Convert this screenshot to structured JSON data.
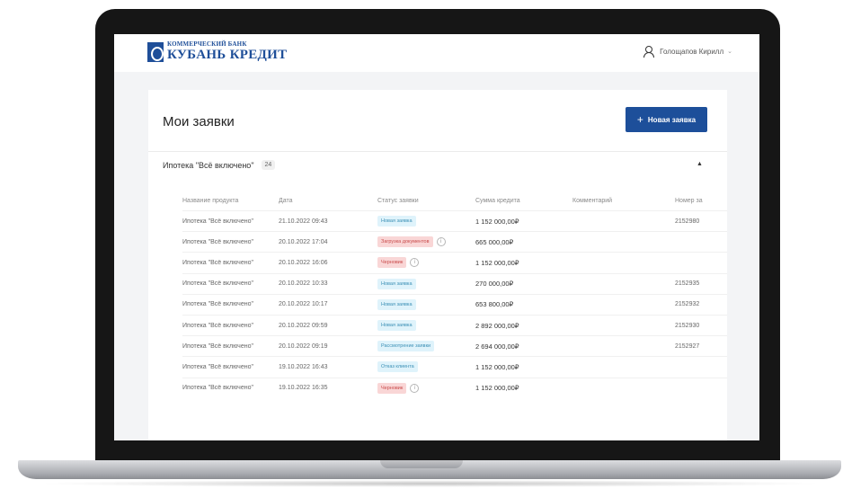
{
  "header": {
    "logo_top": "КОММЕРЧЕСКИЙ БАНК",
    "logo_main": "КУБАНЬ КРЕДИТ",
    "user_name": "Голощапов Кирилл"
  },
  "page": {
    "title": "Мои заявки",
    "new_button_label": "Новая заявка"
  },
  "section": {
    "title": "Ипотека \"Всё включено\"",
    "count": "24"
  },
  "table": {
    "columns": [
      "Название продукта",
      "Дата",
      "Статус заявки",
      "Сумма кредита",
      "Комментарий",
      "Номер за"
    ],
    "rows": [
      {
        "product": "Ипотека \"Всё включено\"",
        "date": "21.10.2022 09:43",
        "status": "Новая заявка",
        "status_color": "#dff3fb",
        "status_text_color": "#3a8fb5",
        "info": false,
        "amount": "1 152 000,00₽",
        "comment": "",
        "number": "2152980"
      },
      {
        "product": "Ипотека \"Всё включено\"",
        "date": "20.10.2022 17:04",
        "status": "Загрузка документов",
        "status_color": "#f9d6d6",
        "status_text_color": "#c94a4a",
        "info": true,
        "amount": "665 000,00₽",
        "comment": "",
        "number": ""
      },
      {
        "product": "Ипотека \"Всё включено\"",
        "date": "20.10.2022 16:06",
        "status": "Черновик",
        "status_color": "#f9d6d6",
        "status_text_color": "#c94a4a",
        "info": true,
        "amount": "1 152 000,00₽",
        "comment": "",
        "number": ""
      },
      {
        "product": "Ипотека \"Всё включено\"",
        "date": "20.10.2022 10:33",
        "status": "Новая заявка",
        "status_color": "#dff3fb",
        "status_text_color": "#3a8fb5",
        "info": false,
        "amount": "270 000,00₽",
        "comment": "",
        "number": "2152935"
      },
      {
        "product": "Ипотека \"Всё включено\"",
        "date": "20.10.2022 10:17",
        "status": "Новая заявка",
        "status_color": "#dff3fb",
        "status_text_color": "#3a8fb5",
        "info": false,
        "amount": "653 800,00₽",
        "comment": "",
        "number": "2152932"
      },
      {
        "product": "Ипотека \"Всё включено\"",
        "date": "20.10.2022 09:59",
        "status": "Новая заявка",
        "status_color": "#dff3fb",
        "status_text_color": "#3a8fb5",
        "info": false,
        "amount": "2 892 000,00₽",
        "comment": "",
        "number": "2152930"
      },
      {
        "product": "Ипотека \"Всё включено\"",
        "date": "20.10.2022 09:19",
        "status": "Рассмотрение заявки",
        "status_color": "#dff3fb",
        "status_text_color": "#3a8fb5",
        "info": false,
        "amount": "2 694 000,00₽",
        "comment": "",
        "number": "2152927"
      },
      {
        "product": "Ипотека \"Всё включено\"",
        "date": "19.10.2022 16:43",
        "status": "Отказ клиента",
        "status_color": "#dff3fb",
        "status_text_color": "#3a8fb5",
        "info": false,
        "amount": "1 152 000,00₽",
        "comment": "",
        "number": ""
      },
      {
        "product": "Ипотека \"Всё включено\"",
        "date": "19.10.2022 16:35",
        "status": "Черновик",
        "status_color": "#f9d6d6",
        "status_text_color": "#c94a4a",
        "info": true,
        "amount": "1 152 000,00₽",
        "comment": "",
        "number": ""
      }
    ]
  },
  "colors": {
    "brand": "#1d4f9a"
  },
  "icons": {
    "user": "user-icon",
    "plus": "plus-icon",
    "collapse": "chevron-up-icon",
    "info": "info-icon",
    "dropdown": "chevron-down-icon"
  }
}
